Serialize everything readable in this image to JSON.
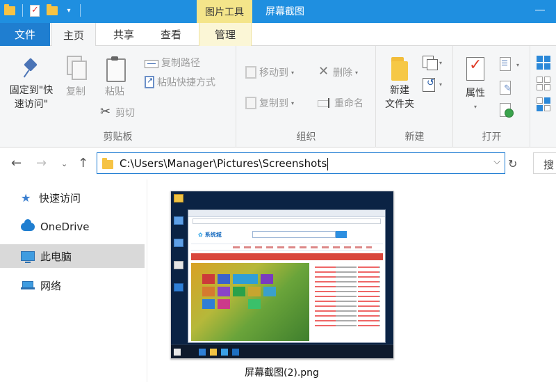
{
  "titlebar": {
    "context_tab": "图片工具",
    "window_title": "屏幕截图"
  },
  "tabs": {
    "file": "文件",
    "home": "主页",
    "share": "共享",
    "view": "查看",
    "manage": "管理"
  },
  "ribbon": {
    "clipboard": {
      "label": "剪贴板",
      "pin_line1": "固定到\"快",
      "pin_line2": "速访问\"",
      "copy": "复制",
      "paste": "粘贴",
      "copy_path": "复制路径",
      "paste_shortcut": "粘贴快捷方式",
      "cut": "剪切"
    },
    "organize": {
      "label": "组织",
      "move_to": "移动到",
      "copy_to": "复制到",
      "delete": "删除",
      "rename": "重命名"
    },
    "new": {
      "label": "新建",
      "new_folder_line1": "新建",
      "new_folder_line2": "文件夹"
    },
    "open": {
      "label": "打开",
      "properties": "属性"
    }
  },
  "address": {
    "path": "C:\\Users\\Manager\\Pictures\\Screenshots",
    "search_label": "搜"
  },
  "nav": {
    "items": [
      {
        "label": "快速访问",
        "icon": "star-icon"
      },
      {
        "label": "OneDrive",
        "icon": "cloud-icon"
      },
      {
        "label": "此电脑",
        "icon": "computer-icon",
        "selected": true
      },
      {
        "label": "网络",
        "icon": "network-icon"
      }
    ]
  },
  "files": [
    {
      "name": "屏幕截图(2).png"
    }
  ],
  "thumbnail": {
    "site_name": "系统城"
  },
  "colors": {
    "titlebar": "#1f8fe0",
    "file_tab": "#1f7ed0",
    "context_tab": "#f4e58a",
    "address_border": "#1b7ad2",
    "nav_selected": "#d9d9d9"
  }
}
